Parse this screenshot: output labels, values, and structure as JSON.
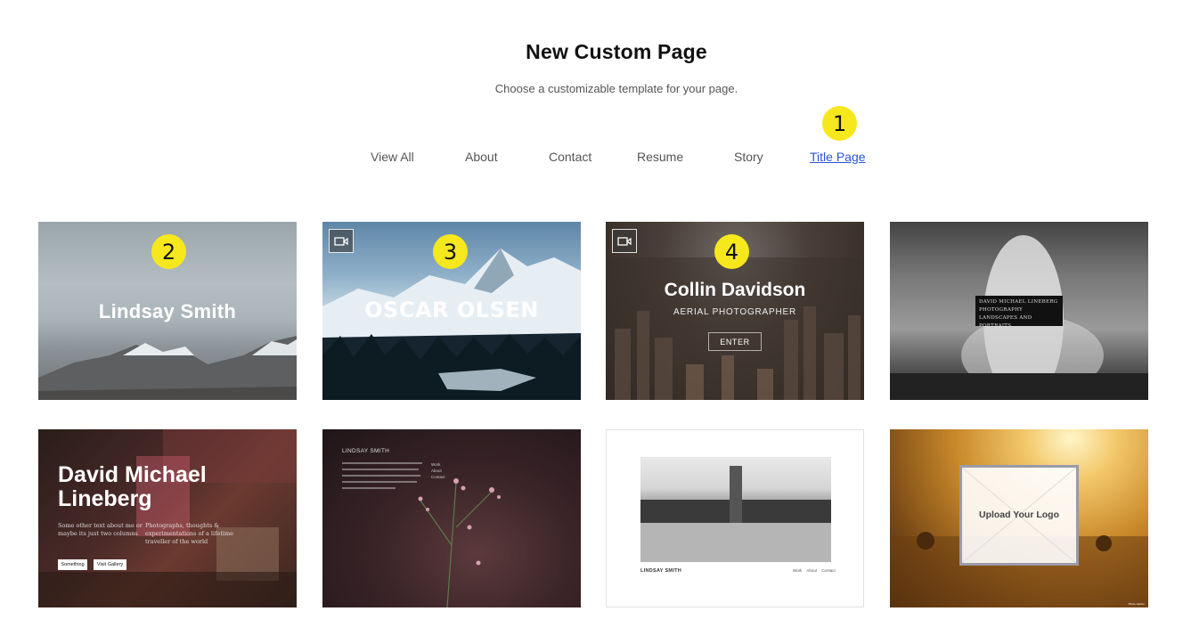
{
  "header": {
    "title": "New Custom Page",
    "subtitle": "Choose a customizable template for your page."
  },
  "tabs": [
    {
      "label": "View All",
      "active": false
    },
    {
      "label": "About",
      "active": false
    },
    {
      "label": "Contact",
      "active": false
    },
    {
      "label": "Resume",
      "active": false
    },
    {
      "label": "Story",
      "active": false
    },
    {
      "label": "Title Page",
      "active": true
    }
  ],
  "markers": [
    "1",
    "2",
    "3",
    "4"
  ],
  "colors": {
    "accent_link": "#2a55d6",
    "marker": "#f6e81c",
    "text_title": "#111111",
    "text_muted": "#555555"
  },
  "templates": [
    {
      "name": "Lindsay Smith",
      "has_video": false
    },
    {
      "name": "OSCAR OLSEN",
      "has_video": true,
      "icon": "video-camera-icon"
    },
    {
      "name": "Collin Davidson",
      "subtitle": "AERIAL PHOTOGRAPHER",
      "button": "ENTER",
      "has_video": true,
      "icon": "video-camera-icon"
    },
    {
      "lines": [
        "DAVID MICHAEL LINEBERG",
        "PHOTOGRAPHY",
        "LANDSCAPES AND PORTRAITS"
      ],
      "has_video": false
    },
    {
      "name_line1": "David Michael",
      "name_line2": "Lineberg",
      "text_left": "Some other text about me or maybe its just two columns",
      "text_right": "Photographs, thoughts & experimentations of a lifetime traveller of the world",
      "buttons": [
        "Something",
        "Visit Gallery"
      ]
    },
    {
      "name": "LINDSAY SMITH",
      "nav": [
        "Work",
        "About",
        "Contact"
      ]
    },
    {
      "name": "LINDSAY SMITH",
      "nav": [
        "Work",
        "About",
        "Contact"
      ]
    },
    {
      "logo_placeholder": "Upload Your Logo",
      "caption": "Photo caption"
    }
  ]
}
